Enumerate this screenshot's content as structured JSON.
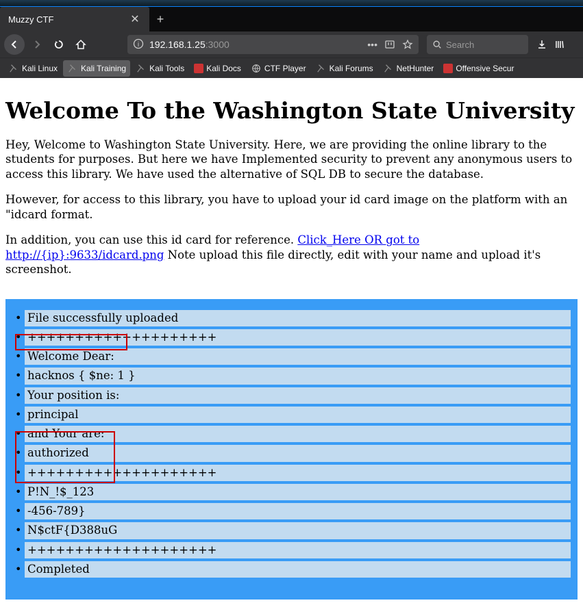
{
  "tab": {
    "title": "Muzzy CTF"
  },
  "url": {
    "host": "192.168.1.25",
    "port": ":3000"
  },
  "search_placeholder": "Search",
  "bookmarks": [
    {
      "label": "Kali Linux",
      "icon": "pin"
    },
    {
      "label": "Kali Training",
      "icon": "pin",
      "active": true
    },
    {
      "label": "Kali Tools",
      "icon": "pin"
    },
    {
      "label": "Kali Docs",
      "icon": "doc"
    },
    {
      "label": "CTF Player",
      "icon": "globe"
    },
    {
      "label": "Kali Forums",
      "icon": "pin"
    },
    {
      "label": "NetHunter",
      "icon": "pin"
    },
    {
      "label": "Offensive Secur",
      "icon": "shield"
    }
  ],
  "page": {
    "heading": "Welcome To the Washington State University",
    "p1": "Hey, Welcome to Washington State University. Here, we are providing the online library to the students for purposes. But here we have Implemented security to prevent any anonymous users to access this library. We have used the alternative of SQL DB to secure the database.",
    "p2": "However, for access to this library, you have to upload your id card image on the platform with an \"idcard format.",
    "p3_a": "In addition, you can use this id card for reference. ",
    "p3_link": "Click_Here OR got to http://{ip}:9633/idcard.png",
    "p3_b": " Note upload this file directly, edit with your name and upload it's screenshot.",
    "list": [
      "File successfully uploaded",
      "++++++++++++++++++++",
      "Welcome Dear:",
      "hacknos { $ne: 1 }",
      "Your position is:",
      "principal",
      "and Your are:",
      "authorized",
      "++++++++++++++++++++",
      "P!N_!$_123",
      "-456-789}",
      "N$ctF{D388uG",
      "++++++++++++++++++++",
      "Completed"
    ]
  }
}
